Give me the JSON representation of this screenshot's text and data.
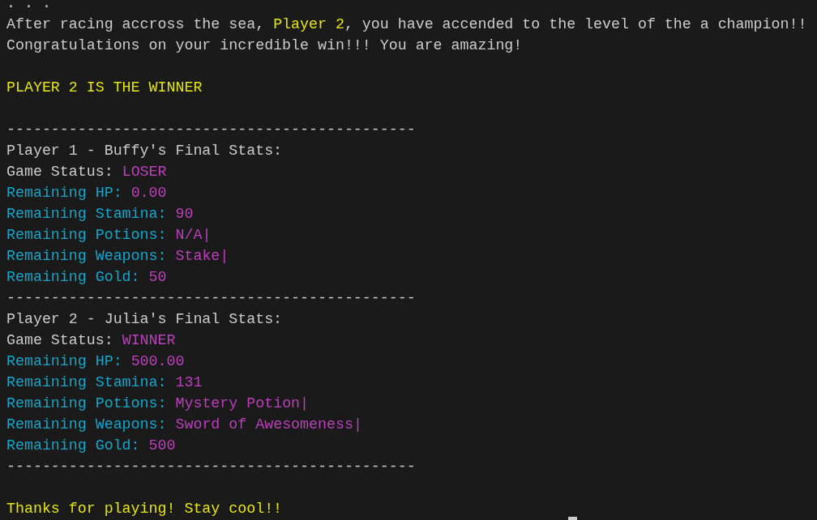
{
  "terminal": {
    "lines": [
      {
        "kind": "text",
        "segments": [
          {
            "text": ". . .",
            "color": "#cccccc"
          }
        ]
      },
      {
        "kind": "text",
        "segments": [
          {
            "text": "After racing accross the sea, ",
            "color": "#cccccc"
          },
          {
            "text": "Player 2",
            "color": "#e5e510"
          },
          {
            "text": ", you have accended to the level of the a champion!!",
            "color": "#cccccc"
          }
        ]
      },
      {
        "kind": "text",
        "segments": [
          {
            "text": "Congratulations on your incredible win!!! You are amazing!",
            "color": "#cccccc"
          }
        ]
      },
      {
        "kind": "blank"
      },
      {
        "kind": "text",
        "segments": [
          {
            "text": "PLAYER 2 IS THE WINNER",
            "color": "#e5e510"
          }
        ]
      },
      {
        "kind": "blank"
      },
      {
        "kind": "rule",
        "text": "----------------------------------------------"
      },
      {
        "kind": "text",
        "segments": [
          {
            "text": "Player 1 - Buffy's Final Stats:",
            "color": "#cccccc"
          }
        ]
      },
      {
        "kind": "pair",
        "label": {
          "text": "Game Status:",
          "color": "#cccccc"
        },
        "value": {
          "text": "LOSER",
          "color": "#bc3fbc"
        }
      },
      {
        "kind": "pair",
        "label": {
          "text": "Remaining HP:",
          "color": "#11a8cd"
        },
        "value": {
          "text": "0.00",
          "color": "#bc3fbc"
        }
      },
      {
        "kind": "pair",
        "label": {
          "text": "Remaining Stamina:",
          "color": "#11a8cd"
        },
        "value": {
          "text": "90",
          "color": "#bc3fbc"
        }
      },
      {
        "kind": "pair",
        "label": {
          "text": "Remaining Potions:",
          "color": "#11a8cd"
        },
        "value": {
          "text": "N/A|",
          "color": "#bc3fbc"
        }
      },
      {
        "kind": "pair",
        "label": {
          "text": "Remaining Weapons:",
          "color": "#11a8cd"
        },
        "value": {
          "text": "Stake|",
          "color": "#bc3fbc"
        }
      },
      {
        "kind": "pair",
        "label": {
          "text": "Remaining Gold:",
          "color": "#11a8cd"
        },
        "value": {
          "text": "50",
          "color": "#bc3fbc"
        }
      },
      {
        "kind": "rule",
        "text": "----------------------------------------------"
      },
      {
        "kind": "text",
        "segments": [
          {
            "text": "Player 2 - Julia's Final Stats:",
            "color": "#cccccc"
          }
        ]
      },
      {
        "kind": "pair",
        "label": {
          "text": "Game Status:",
          "color": "#cccccc"
        },
        "value": {
          "text": "WINNER",
          "color": "#bc3fbc"
        }
      },
      {
        "kind": "pair",
        "label": {
          "text": "Remaining HP:",
          "color": "#11a8cd"
        },
        "value": {
          "text": "500.00",
          "color": "#bc3fbc"
        }
      },
      {
        "kind": "pair",
        "label": {
          "text": "Remaining Stamina:",
          "color": "#11a8cd"
        },
        "value": {
          "text": "131",
          "color": "#bc3fbc"
        }
      },
      {
        "kind": "pair",
        "label": {
          "text": "Remaining Potions:",
          "color": "#11a8cd"
        },
        "value": {
          "text": "Mystery Potion|",
          "color": "#bc3fbc"
        }
      },
      {
        "kind": "pair",
        "label": {
          "text": "Remaining Weapons:",
          "color": "#11a8cd"
        },
        "value": {
          "text": "Sword of Awesomeness|",
          "color": "#bc3fbc"
        }
      },
      {
        "kind": "pair",
        "label": {
          "text": "Remaining Gold:",
          "color": "#11a8cd"
        },
        "value": {
          "text": "500",
          "color": "#bc3fbc"
        }
      },
      {
        "kind": "rule",
        "text": "----------------------------------------------"
      },
      {
        "kind": "blank"
      },
      {
        "kind": "text",
        "segments": [
          {
            "text": "Thanks for playing! Stay cool!!",
            "color": "#e5e510"
          }
        ]
      }
    ]
  }
}
